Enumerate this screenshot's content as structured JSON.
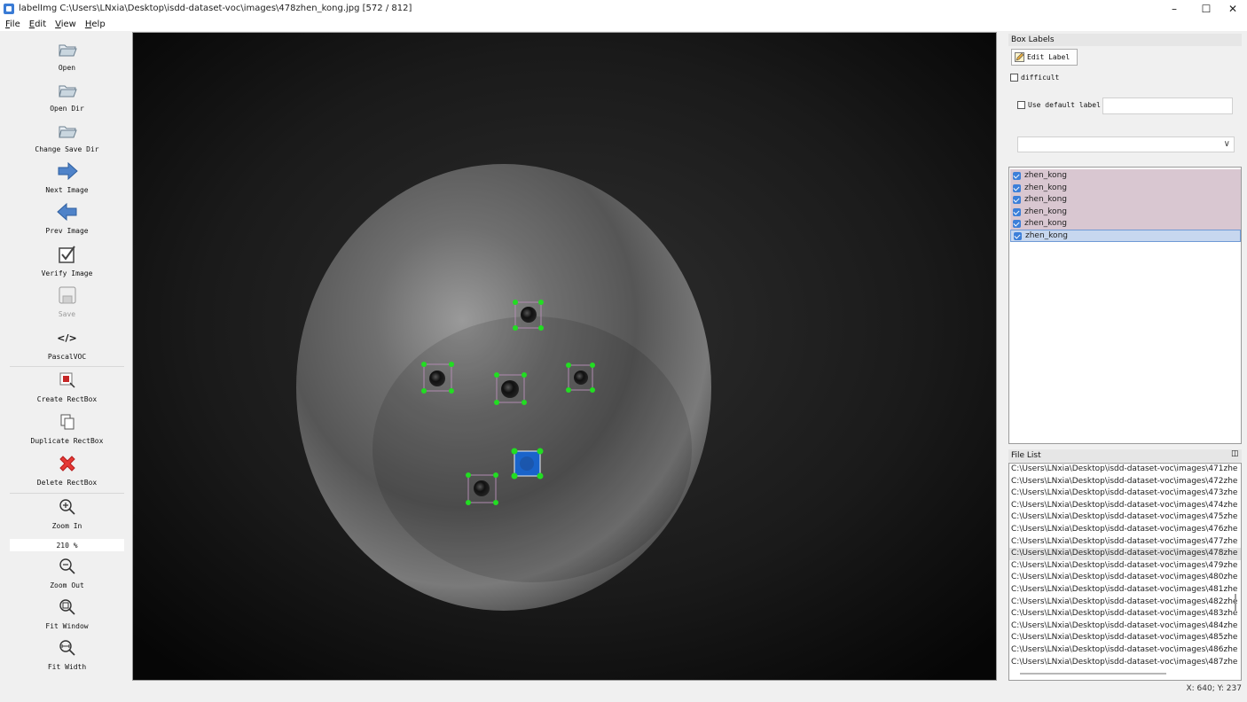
{
  "window": {
    "title": "labelImg C:\\Users\\LNxia\\Desktop\\isdd-dataset-voc\\images\\478zhen_kong.jpg [572 / 812]",
    "controls": {
      "minimize": "–",
      "maximize": "☐",
      "close": "✕"
    }
  },
  "menu": [
    {
      "first": "F",
      "rest": "ile"
    },
    {
      "first": "E",
      "rest": "dit"
    },
    {
      "first": "V",
      "rest": "iew"
    },
    {
      "first": "H",
      "rest": "elp"
    }
  ],
  "toolbar": {
    "open": "Open",
    "open_dir": "Open Dir",
    "change_save_dir": "Change Save Dir",
    "next_image": "Next Image",
    "prev_image": "Prev Image",
    "verify_image": "Verify Image",
    "save": "Save",
    "format_icon_text": "</>",
    "format": "PascalVOC",
    "create_rectbox": "Create RectBox",
    "duplicate_rectbox": "Duplicate RectBox",
    "delete_rectbox": "Delete RectBox",
    "zoom_in": "Zoom In",
    "zoom_value": "210 %",
    "zoom_out": "Zoom Out",
    "fit_window": "Fit Window",
    "fit_width": "Fit Width"
  },
  "box_labels": {
    "title": "Box Labels",
    "edit_label": "Edit Label",
    "difficult": "difficult",
    "use_default_label": "Use default label",
    "default_label_value": "",
    "combo_value": "",
    "labels": [
      {
        "text": "zhen_kong",
        "checked": true,
        "selected": false
      },
      {
        "text": "zhen_kong",
        "checked": true,
        "selected": false
      },
      {
        "text": "zhen_kong",
        "checked": true,
        "selected": false
      },
      {
        "text": "zhen_kong",
        "checked": true,
        "selected": false
      },
      {
        "text": "zhen_kong",
        "checked": true,
        "selected": false
      },
      {
        "text": "zhen_kong",
        "checked": true,
        "selected": true
      }
    ]
  },
  "file_list": {
    "title": "File List",
    "files": [
      "C:\\Users\\LNxia\\Desktop\\isdd-dataset-voc\\images\\471zhe",
      "C:\\Users\\LNxia\\Desktop\\isdd-dataset-voc\\images\\472zhe",
      "C:\\Users\\LNxia\\Desktop\\isdd-dataset-voc\\images\\473zhe",
      "C:\\Users\\LNxia\\Desktop\\isdd-dataset-voc\\images\\474zhe",
      "C:\\Users\\LNxia\\Desktop\\isdd-dataset-voc\\images\\475zhe",
      "C:\\Users\\LNxia\\Desktop\\isdd-dataset-voc\\images\\476zhe",
      "C:\\Users\\LNxia\\Desktop\\isdd-dataset-voc\\images\\477zhe",
      "C:\\Users\\LNxia\\Desktop\\isdd-dataset-voc\\images\\478zhe",
      "C:\\Users\\LNxia\\Desktop\\isdd-dataset-voc\\images\\479zhe",
      "C:\\Users\\LNxia\\Desktop\\isdd-dataset-voc\\images\\480zhe",
      "C:\\Users\\LNxia\\Desktop\\isdd-dataset-voc\\images\\481zhe",
      "C:\\Users\\LNxia\\Desktop\\isdd-dataset-voc\\images\\482zhe",
      "C:\\Users\\LNxia\\Desktop\\isdd-dataset-voc\\images\\483zhe",
      "C:\\Users\\LNxia\\Desktop\\isdd-dataset-voc\\images\\484zhe",
      "C:\\Users\\LNxia\\Desktop\\isdd-dataset-voc\\images\\485zhe",
      "C:\\Users\\LNxia\\Desktop\\isdd-dataset-voc\\images\\486zhe",
      "C:\\Users\\LNxia\\Desktop\\isdd-dataset-voc\\images\\487zhe"
    ],
    "current_index": 7
  },
  "status": {
    "coords": "X: 640; Y: 237"
  },
  "colors": {
    "label_row": "#d9c7d1",
    "selected_row": "#c7d7ef",
    "box_handle": "#22dd22",
    "box_fill_selected": "#1466d8"
  }
}
